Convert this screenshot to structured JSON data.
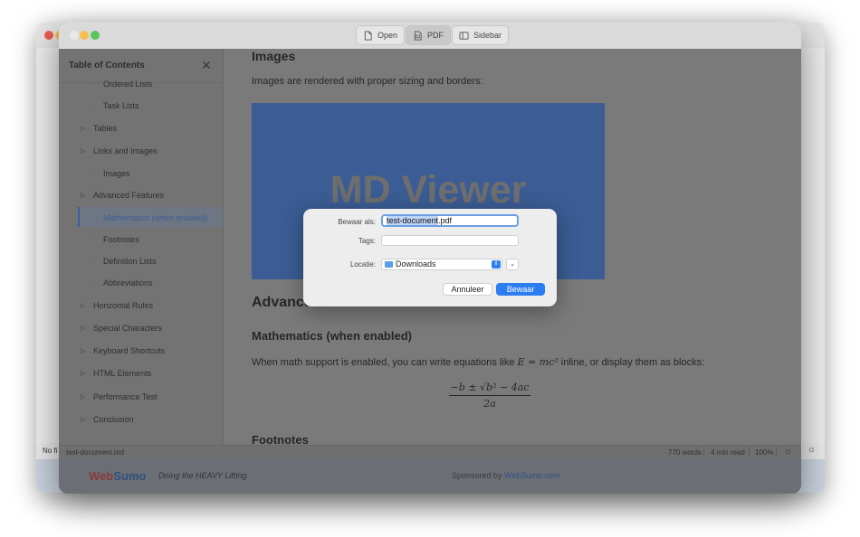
{
  "background_window": {
    "status_text": "No fi"
  },
  "toolbar": {
    "open_label": "Open",
    "pdf_label": "PDF",
    "sidebar_label": "Sidebar"
  },
  "sidebar": {
    "title": "Table of Contents",
    "items": [
      {
        "label": "Ordered Lists",
        "level": 2
      },
      {
        "label": "Task Lists",
        "level": 2
      },
      {
        "label": "Tables",
        "level": 1
      },
      {
        "label": "Links and Images",
        "level": 1
      },
      {
        "label": "Images",
        "level": 2
      },
      {
        "label": "Advanced Features",
        "level": 1
      },
      {
        "label": "Mathematics (when enabled)",
        "level": 2,
        "active": true
      },
      {
        "label": "Footnotes",
        "level": 2
      },
      {
        "label": "Definition Lists",
        "level": 2
      },
      {
        "label": "Abbreviations",
        "level": 2
      },
      {
        "label": "Horizontal Rules",
        "level": 1
      },
      {
        "label": "Special Characters",
        "level": 1
      },
      {
        "label": "Keyboard Shortcuts",
        "level": 1
      },
      {
        "label": "HTML Elements",
        "level": 1
      },
      {
        "label": "Performance Test",
        "level": 1
      },
      {
        "label": "Conclusion",
        "level": 1
      }
    ]
  },
  "content": {
    "images_heading": "Images",
    "images_paragraph": "Images are rendered with proper sizing and borders:",
    "image_text": "MD Viewer",
    "advanced_heading": "Advanced Features",
    "math_heading": "Mathematics (when enabled)",
    "math_paragraph_before": "When math support is enabled, you can write equations like ",
    "math_inline": "E = mc²",
    "math_paragraph_after": " inline, or display them as blocks:",
    "formula_numerator": "−b ± √b² − 4ac",
    "formula_denominator": "2a",
    "footnotes_heading": "Footnotes"
  },
  "status_bar": {
    "filename": "test-document.md",
    "words": "770 words",
    "read_time": "4 min read",
    "zoom": "100%"
  },
  "footer": {
    "brand_web": "Web",
    "brand_sumo": "Sumo",
    "tagline": "Doing the HEAVY Lifting",
    "sponsor_prefix": "Sponsored by ",
    "sponsor_link": "WebSumo.com"
  },
  "dialog": {
    "save_as_label": "Bewaar als:",
    "filename_selected": "test-document",
    "filename_ext": ".pdf",
    "tags_label": "Tags:",
    "location_label": "Locatie:",
    "location_value": "Downloads",
    "cancel_label": "Annuleer",
    "save_label": "Bewaar"
  },
  "colors": {
    "accent": "#2c7df2",
    "window_dim": "#7a7a7a",
    "image_bg": "#3b5c94"
  }
}
